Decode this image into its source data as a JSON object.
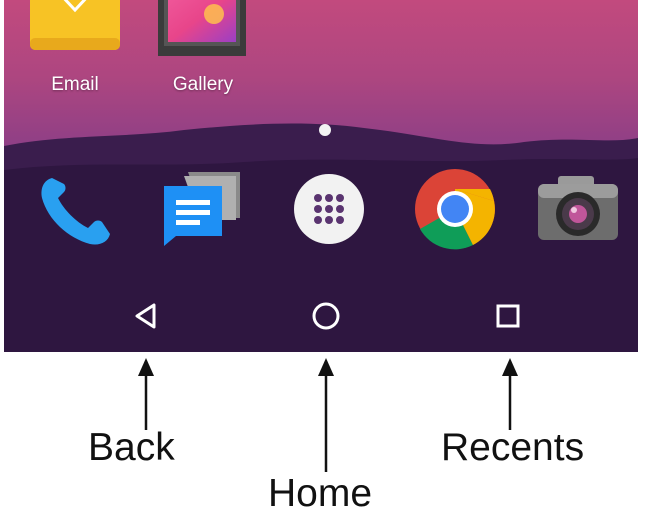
{
  "apps": {
    "email_label": "Email",
    "gallery_label": "Gallery"
  },
  "dock": {
    "items": [
      "phone-icon",
      "messenger-icon",
      "app-drawer-icon",
      "chrome-icon",
      "camera-icon"
    ]
  },
  "navigation": {
    "back": "back-icon",
    "home": "home-icon",
    "recents": "recents-icon"
  },
  "callouts": {
    "back": "Back",
    "home": "Home",
    "recents": "Recents"
  },
  "colors": {
    "nav_bar": "#2a1436",
    "callout_text": "#111111"
  }
}
